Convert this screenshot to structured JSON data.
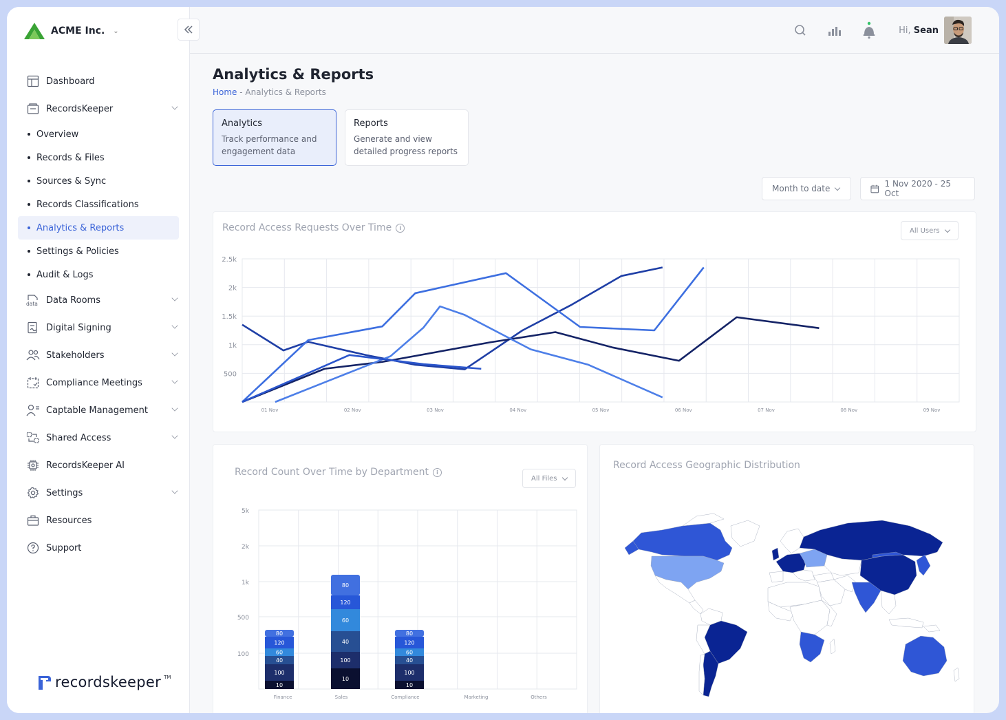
{
  "org": {
    "name": "ACME Inc."
  },
  "sidebar": {
    "items": [
      {
        "label": "Dashboard",
        "icon": "dashboard-icon",
        "expandable": false
      },
      {
        "label": "RecordsKeeper",
        "icon": "records-icon",
        "expandable": true
      }
    ],
    "subitems": [
      {
        "label": "Overview",
        "active": false
      },
      {
        "label": "Records & Files",
        "active": false
      },
      {
        "label": "Sources & Sync",
        "active": false
      },
      {
        "label": "Records Classifications",
        "active": false
      },
      {
        "label": "Analytics & Reports",
        "active": true
      },
      {
        "label": "Settings & Policies",
        "active": false
      },
      {
        "label": "Audit & Logs",
        "active": false
      }
    ],
    "items2": [
      {
        "label": "Data Rooms",
        "icon": "data-rooms-icon",
        "expandable": true
      },
      {
        "label": "Digital Signing",
        "icon": "digital-signing-icon",
        "expandable": true
      },
      {
        "label": "Stakeholders",
        "icon": "stakeholders-icon",
        "expandable": true
      },
      {
        "label": "Compliance Meetings",
        "icon": "calendar-icon",
        "expandable": true
      },
      {
        "label": "Captable Management",
        "icon": "captable-icon",
        "expandable": true
      },
      {
        "label": "Shared Access",
        "icon": "shared-access-icon",
        "expandable": true
      },
      {
        "label": "RecordsKeeper AI",
        "icon": "ai-chip-icon",
        "expandable": false
      },
      {
        "label": "Settings",
        "icon": "gear-icon",
        "expandable": true
      },
      {
        "label": "Resources",
        "icon": "briefcase-icon",
        "expandable": false
      },
      {
        "label": "Support",
        "icon": "help-icon",
        "expandable": false
      }
    ],
    "logo_text": "recordskeeper",
    "logo_tm": "TM"
  },
  "header": {
    "greeting": "Hi,",
    "user": "Sean"
  },
  "page": {
    "title": "Analytics & Reports",
    "breadcrumb_home": "Home",
    "breadcrumb_sep": " - ",
    "breadcrumb_current": "Analytics & Reports"
  },
  "tabs": [
    {
      "title": "Analytics",
      "desc": "Track performance and engagement data",
      "active": true
    },
    {
      "title": "Reports",
      "desc": "Generate and view detailed progress reports",
      "active": false
    }
  ],
  "filters": {
    "period": "Month to date",
    "date_range": "1 Nov 2020 - 25 Oct"
  },
  "colors": {
    "accent": "#3b64d8",
    "line1": "#1f3fa6",
    "line2": "#3d6fe0",
    "line3": "#142366",
    "line4": "#4d7fe8",
    "line5": "#2a55cc",
    "map_dark": "#0a2493",
    "map_mid": "#2f56d6",
    "map_light": "#7ea4f2"
  },
  "line_card": {
    "title": "Record Access Requests Over Time",
    "filter": "All Users"
  },
  "bar_card": {
    "title": "Record Count Over Time by Department",
    "filter": "All Files"
  },
  "map_card": {
    "title": "Record Access Geographic Distribution"
  },
  "chart_data": [
    {
      "type": "line",
      "title": "Record Access Requests Over Time",
      "x_ticks": [
        "01 Nov",
        "02 Nov",
        "03 Nov",
        "04 Nov",
        "05 Nov",
        "06 Nov",
        "07 Nov",
        "08 Nov",
        "09 Nov"
      ],
      "y_ticks": [
        "500",
        "1k",
        "1.5k",
        "2k",
        "2.5k"
      ],
      "ylim": [
        0,
        2500
      ],
      "xlim": [
        0.7,
        9.4
      ],
      "grid": true,
      "series": [
        {
          "x": [
            0.7,
            1.2,
            1.5,
            2.2,
            2.8,
            3.4,
            4.1,
            4.7,
            5.3,
            5.8
          ],
          "y": [
            1350,
            900,
            1050,
            820,
            650,
            570,
            1250,
            1700,
            2200,
            2350
          ]
        },
        {
          "x": [
            0.7,
            1.5,
            2.4,
            2.8,
            3.9,
            4.8,
            5.7,
            6.3
          ],
          "y": [
            0,
            1080,
            1320,
            1900,
            2250,
            1310,
            1250,
            2350
          ]
        },
        {
          "x": [
            0.7,
            1.7,
            2.4,
            3.7,
            4.5,
            5.2,
            6.0,
            6.7,
            7.7
          ],
          "y": [
            0,
            580,
            700,
            1040,
            1220,
            950,
            720,
            1480,
            1290
          ]
        },
        {
          "x": [
            1.1,
            1.8,
            2.5,
            2.9,
            3.1,
            3.4,
            4.2,
            4.9,
            5.8
          ],
          "y": [
            0,
            400,
            800,
            1300,
            1670,
            1520,
            920,
            650,
            80
          ]
        },
        {
          "x": [
            0.7,
            2.0,
            2.9,
            3.6
          ],
          "y": [
            0,
            820,
            660,
            580
          ]
        }
      ]
    },
    {
      "type": "bar",
      "title": "Record Count Over Time by Department",
      "categories": [
        "Finance",
        "Sales",
        "Compliance",
        "Marketing",
        "Others"
      ],
      "y_ticks": [
        "100",
        "500",
        "1k",
        "2k",
        "5k"
      ],
      "stack_order": [
        "10",
        "100",
        "40",
        "60",
        "120",
        "80"
      ],
      "series": [
        {
          "name": "10",
          "values": [
            10,
            10,
            10,
            0,
            0
          ],
          "color": "#0b1030"
        },
        {
          "name": "100",
          "values": [
            100,
            100,
            100,
            0,
            0
          ],
          "color": "#1d2e6b"
        },
        {
          "name": "40",
          "values": [
            40,
            40,
            40,
            0,
            0
          ],
          "color": "#274f93"
        },
        {
          "name": "60",
          "values": [
            60,
            60,
            60,
            0,
            0
          ],
          "color": "#3289dc"
        },
        {
          "name": "120",
          "values": [
            120,
            120,
            120,
            0,
            0
          ],
          "color": "#2757d8"
        },
        {
          "name": "80",
          "values": [
            80,
            80,
            80,
            0,
            0
          ],
          "color": "#4170e0"
        }
      ]
    }
  ]
}
